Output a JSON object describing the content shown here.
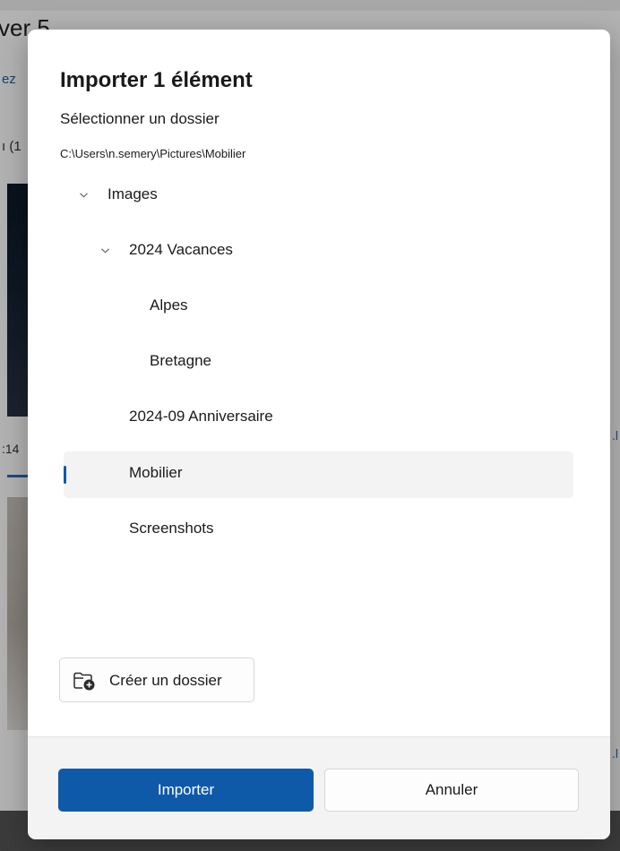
{
  "background": {
    "title_fragment": "ver 5",
    "link_fragment": "ez",
    "small_fragment": "ı (1",
    "number_fragment": ":14",
    "right_mark": ".l"
  },
  "dialog": {
    "title": "Importer 1 élément",
    "subtitle": "Sélectionner un dossier",
    "path": "C:\\Users\\n.semery\\Pictures\\Mobilier",
    "tree": [
      {
        "label": "Images",
        "level": 0,
        "expanded": true,
        "selected": false
      },
      {
        "label": "2024 Vacances",
        "level": 1,
        "expanded": true,
        "selected": false
      },
      {
        "label": "Alpes",
        "level": 2,
        "expanded": false,
        "selected": false
      },
      {
        "label": "Bretagne",
        "level": 2,
        "expanded": false,
        "selected": false
      },
      {
        "label": "2024-09 Anniversaire",
        "level": 1,
        "expanded": false,
        "selected": false
      },
      {
        "label": "Mobilier",
        "level": 1,
        "expanded": false,
        "selected": true
      },
      {
        "label": "Screenshots",
        "level": 1,
        "expanded": false,
        "selected": false
      }
    ],
    "new_folder_label": "Créer un dossier",
    "primary_label": "Importer",
    "secondary_label": "Annuler"
  },
  "icons": {
    "chevron": "chevron-down-icon",
    "new_folder": "folder-add-icon"
  },
  "colors": {
    "accent": "#0f5aa8",
    "selected_row": "#f3f3f3",
    "footer": "#f3f3f3",
    "overlay": "#7c7c7c"
  }
}
